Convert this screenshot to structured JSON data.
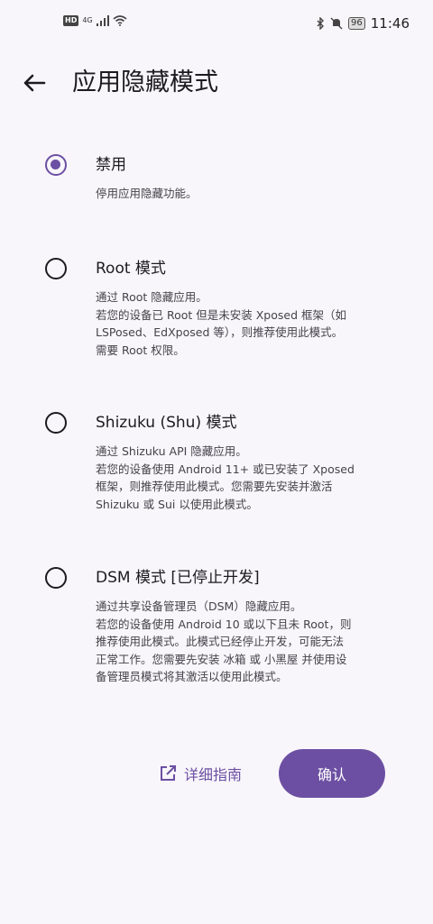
{
  "status_bar": {
    "hd": "HD",
    "network": "4G",
    "battery": "96",
    "time": "11:46"
  },
  "header": {
    "title": "应用隐藏模式"
  },
  "options": [
    {
      "title": "禁用",
      "checked": true,
      "desc": [
        "停用应用隐藏功能。"
      ]
    },
    {
      "title": "Root 模式",
      "checked": false,
      "desc": [
        "通过 Root 隐藏应用。",
        "若您的设备已 Root 但是未安装 Xposed 框架（如",
        "LSPosed、EdXposed 等），则推荐使用此模式。",
        "需要 Root 权限。"
      ]
    },
    {
      "title": "Shizuku (Shu) 模式",
      "checked": false,
      "desc": [
        "通过 Shizuku API 隐藏应用。",
        "若您的设备使用 Android 11+ 或已安装了 Xposed",
        "框架，则推荐使用此模式。您需要先安装并激活",
        "Shizuku 或 Sui 以使用此模式。"
      ]
    },
    {
      "title": "DSM 模式 [已停止开发]",
      "checked": false,
      "desc": [
        "通过共享设备管理员（DSM）隐藏应用。",
        "若您的设备使用 Android 10 或以下且未 Root，则",
        "推荐使用此模式。此模式已经停止开发，可能无法",
        "正常工作。您需要先安装 冰箱 或 小黑屋 并使用设",
        "备管理员模式将其激活以使用此模式。"
      ]
    }
  ],
  "actions": {
    "guide_label": "详细指南",
    "confirm_label": "确认"
  },
  "colors": {
    "accent": "#6c4fa2",
    "background": "#f8f6fb"
  }
}
